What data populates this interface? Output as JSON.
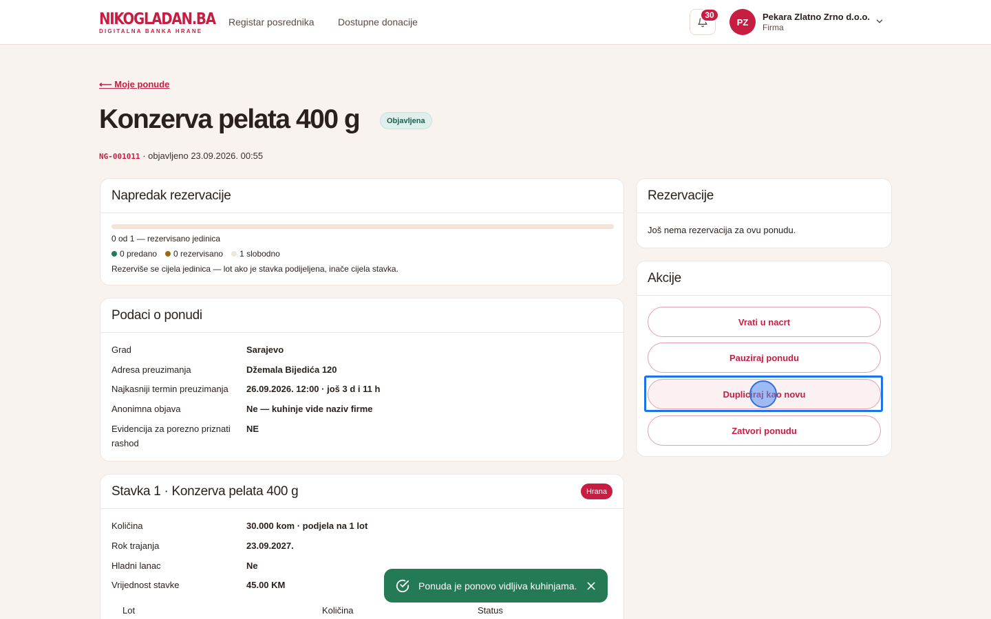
{
  "header": {
    "logo_main_dark": "NIKO",
    "logo_main_red": "GLADAN.BA",
    "logo_sub": "DIGITALNA BANKA HRANE",
    "nav": [
      "Registar posrednika",
      "Dostupne donacije"
    ],
    "notifications_count": "30",
    "user": {
      "initials": "PZ",
      "name": "Pekara Zlatno Zrno d.o.o.",
      "role": "Firma"
    }
  },
  "page": {
    "back_link": "⟵ Moje ponude",
    "title": "Konzerva pelata 400 g",
    "status": "Objavljena",
    "code": "NG-001011",
    "published": " · objavljeno 23.09.2026. 00:55"
  },
  "progress_card": {
    "title": "Napredak rezervacije",
    "reserved_fraction": 0,
    "summary": "0 od 1 — rezervisano jedinica",
    "legend": [
      {
        "label": "0 predano",
        "color": "#1f7a5c"
      },
      {
        "label": "0 rezervisano",
        "color": "#9a6a10"
      },
      {
        "label": "1 slobodno",
        "color": "#f1e4d8"
      }
    ],
    "note": "Rezerviše se cijela jedinica — lot ako je stavka podijeljena, inače cijela stavka."
  },
  "details_card": {
    "title": "Podaci o ponudi",
    "rows": [
      {
        "k": "Grad",
        "v": "Sarajevo"
      },
      {
        "k": "Adresa preuzimanja",
        "v": "Džemala Bijedića 120"
      },
      {
        "k": "Najkasniji termin preuzimanja",
        "v": "26.09.2026. 12:00 · još 3 d i 11 h"
      },
      {
        "k": "Anonimna objava",
        "v": "Ne — kuhinje vide naziv firme"
      },
      {
        "k": "Evidencija za porezno priznati rashod",
        "v": "NE"
      }
    ]
  },
  "item_card": {
    "title": "Stavka 1 · Konzerva pelata 400 g",
    "category": "Hrana",
    "rows": [
      {
        "k": "Količina",
        "v": "30.000 kom · podjela na 1 lot"
      },
      {
        "k": "Rok trajanja",
        "v": "23.09.2027."
      },
      {
        "k": "Hladni lanac",
        "v": "Ne"
      },
      {
        "k": "Vrijednost stavke",
        "v": "45.00 KM"
      }
    ],
    "lot_columns": [
      "Lot",
      "Količina",
      "Status"
    ]
  },
  "reservations_card": {
    "title": "Rezervacije",
    "empty": "Još nema rezervacija za ovu ponudu."
  },
  "actions_card": {
    "title": "Akcije",
    "buttons": [
      "Vrati u nacrt",
      "Pauziraj ponudu",
      "Dupliciraj kao novu",
      "Zatvori ponudu"
    ]
  },
  "toast": {
    "message": "Ponuda je ponovo vidljiva kuhinjama."
  },
  "colors": {
    "brand": "#c81d42",
    "success": "#237a55",
    "background": "#f8f3ef"
  }
}
